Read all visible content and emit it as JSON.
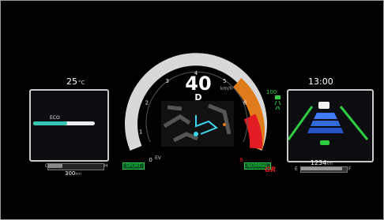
{
  "left": {
    "temperature": "25",
    "temp_unit": "°C",
    "eco_label": "ECO",
    "eco_level": 0.55,
    "fuel_empty": "C",
    "fuel_full": "H",
    "range_value": "300",
    "range_unit": "km"
  },
  "center": {
    "speed": "40",
    "gear": "D",
    "speed_unit": "km/h",
    "ticks": [
      "0",
      "1",
      "2",
      "3",
      "4",
      "5",
      "6",
      "7",
      "8"
    ],
    "drive_mode_left": "SPORT",
    "drive_mode_right": "NORMAL",
    "brand_badge": "GR",
    "ev_indicator": "EV"
  },
  "right": {
    "clock": "13:00",
    "acc_set_speed": "100",
    "odometer_value": "1234",
    "odometer_unit": "km",
    "fuel_empty": "E",
    "fuel_full": "F"
  },
  "colors": {
    "eco": "#35c7b3",
    "mode_green": "#2ecc40",
    "redline": "#e31b23",
    "lane_blue": "#2f6bff",
    "map_route": "#3ad8ee"
  }
}
